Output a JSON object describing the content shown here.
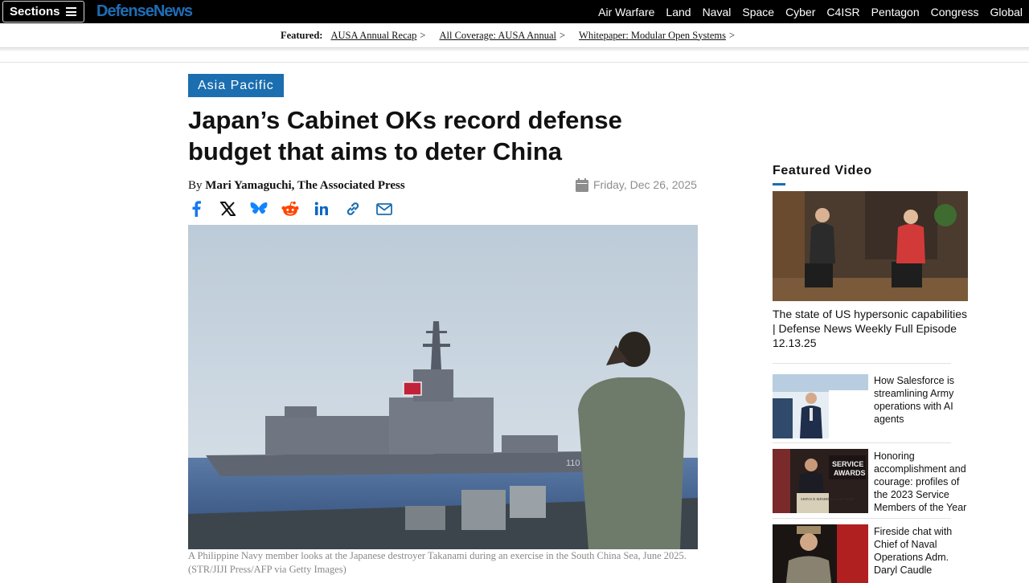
{
  "nav": {
    "sections_label": "Sections",
    "logo": "DefenseNews",
    "links": [
      "Air Warfare",
      "Land",
      "Naval",
      "Space",
      "Cyber",
      "C4ISR",
      "Pentagon",
      "Congress",
      "Global"
    ]
  },
  "featured_bar": {
    "label": "Featured:",
    "links": [
      {
        "text": "AUSA Annual Recap",
        "chevron": ">"
      },
      {
        "text": "All Coverage: AUSA Annual",
        "chevron": ">"
      },
      {
        "text": "Whitepaper: Modular Open Systems",
        "chevron": ">"
      }
    ]
  },
  "article": {
    "kicker": "Asia Pacific",
    "headline": "Japan’s Cabinet OKs record defense budget that aims to deter China",
    "byline_prefix": "By ",
    "author": "Mari Yamaguchi, The Associated Press",
    "date": "Friday, Dec 26, 2025",
    "share_icons": [
      "facebook-icon",
      "x-icon",
      "bluesky-icon",
      "reddit-icon",
      "linkedin-icon",
      "link-icon",
      "email-icon"
    ],
    "caption": "A Philippine Navy member looks at the Japanese destroyer Takanami during an exercise in the South China Sea, June 2025. (STR/JIJI Press/AFP via Getty Images)",
    "hull_number": "110"
  },
  "sidebar": {
    "featured_video_title": "Featured Video",
    "featured_video_caption": "The state of US hypersonic capabilities | Defense News Weekly Full Episode 12.13.25",
    "related": [
      {
        "title": "How Salesforce is streamlining Army operations with AI agents"
      },
      {
        "title": "Honoring accomplishment and courage: profiles of the 2023 Service Members of the Year",
        "sign_line1": "SERVICE",
        "sign_line2": "AWARDS",
        "podium": "SERVICE MEMBERS of the YEAR"
      },
      {
        "title": "Fireside chat with Chief of Naval Operations Adm. Daryl Caudle"
      }
    ]
  },
  "colors": {
    "nav_bg": "#000000",
    "accent_blue": "#1b6eaf",
    "reddit_orange": "#ff4500",
    "bluesky_blue": "#1185fe"
  }
}
